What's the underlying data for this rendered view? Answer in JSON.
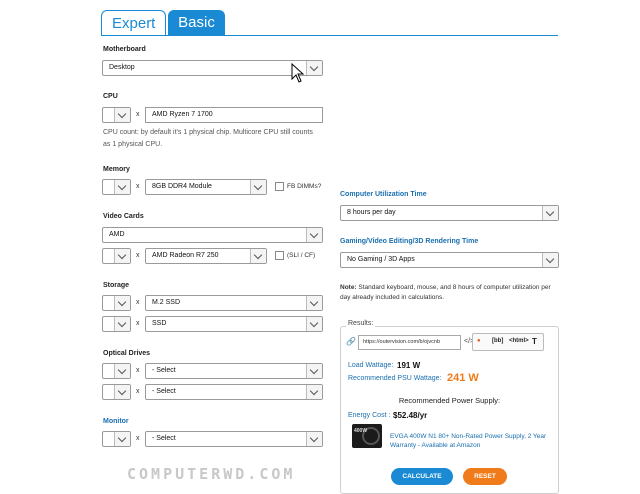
{
  "tabs": {
    "expert": "Expert",
    "basic": "Basic"
  },
  "motherboard": {
    "label": "Motherboard",
    "value": "Desktop"
  },
  "cpu": {
    "label": "CPU",
    "value": "AMD Ryzen 7 1700",
    "help_line1": "CPU count: by default it's 1 physical chip. Multicore CPU still counts",
    "help_line2": "as 1 physical CPU."
  },
  "memory": {
    "label": "Memory",
    "value": "8GB DDR4 Module",
    "fb_label": "FB DIMMs?"
  },
  "video": {
    "label": "Video Cards",
    "brand": "AMD",
    "model": "AMD Radeon R7 250",
    "sli_label": "(SLI / CF)"
  },
  "storage": {
    "label": "Storage",
    "drive1": "M.2 SSD",
    "drive2": "SSD"
  },
  "optical": {
    "label": "Optical Drives",
    "drive1": "- Select",
    "drive2": "- Select"
  },
  "monitor": {
    "label": "Monitor",
    "value": "- Select"
  },
  "times": {
    "x": "x"
  },
  "utilization": {
    "label": "Computer Utilization Time",
    "value": "8 hours per day"
  },
  "gaming": {
    "label": "Gaming/Video Editing/3D Rendering Time",
    "value": "No Gaming / 3D Apps"
  },
  "note": {
    "bold": "Note:",
    "text": " Standard keyboard, mouse, and 8 hours of computer utilization per day already included in calculations."
  },
  "results": {
    "legend": "Results:",
    "share_url": "https://outervision.com/b/ojvcnb",
    "share_icons": {
      "bb": "[bb]",
      "html": "<html>",
      "t": "T"
    },
    "load_label": "Load Wattage:",
    "load_value": "191 W",
    "psu_label": "Recommended PSU Wattage:",
    "psu_value": "241 W",
    "rec_title": "Recommended Power Supply:",
    "energy_label": "Energy Cost :",
    "energy_value": "$52.48/yr",
    "psu_product": "EVGA 400W N1 80+ Non-Rated Power Supply, 2 Year Warranty - Available at Amazon",
    "calculate": "CALCULATE",
    "reset": "RESET"
  },
  "watermark": "COMPUTERWD.COM"
}
